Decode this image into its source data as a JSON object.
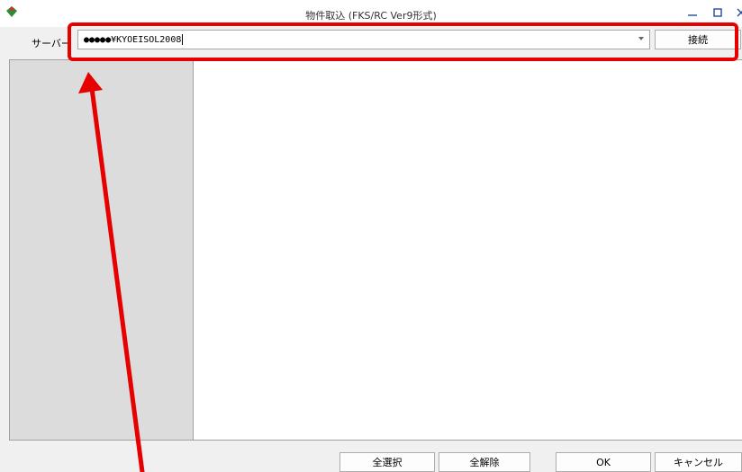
{
  "window": {
    "title": "物件取込 (FKS/RC Ver9形式)",
    "app_icon": "app-logo-icon",
    "controls": [
      "minimize-icon",
      "maximize-icon",
      "close-icon"
    ]
  },
  "server": {
    "label": "サーバー",
    "value": "●●●●●¥KYOEISOL2008",
    "connect_label": "接続"
  },
  "footer": {
    "select_all_label": "全選択",
    "deselect_all_label": "全解除",
    "ok_label": "OK",
    "cancel_label": "キャンセル"
  },
  "colors": {
    "annotation": "#e60000",
    "left_panel": "#dcdcdc",
    "background": "#f0f0f0"
  }
}
